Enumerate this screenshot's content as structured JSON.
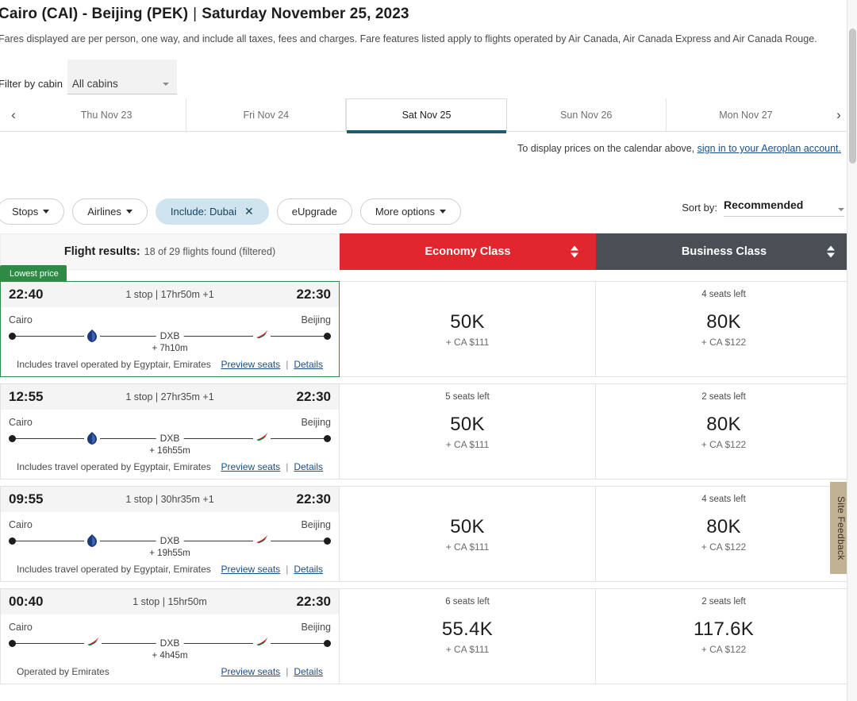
{
  "header": {
    "route": "Cairo (CAI) - Beijing (PEK)",
    "separator": "|",
    "date": "Saturday November 25, 2023",
    "disclaimer": "Fares displayed are per person, one way, and include all taxes, fees and charges. Fare features listed apply to flights operated by Air Canada, Air Canada Express and Air Canada Rouge."
  },
  "cabin_filter": {
    "label": "Filter by cabin",
    "value": "All cabins"
  },
  "date_tabs": {
    "prev_icon": "‹",
    "next_icon": "›",
    "items": [
      {
        "label": "Thu Nov 23",
        "active": false
      },
      {
        "label": "Fri Nov 24",
        "active": false
      },
      {
        "label": "Sat Nov 25",
        "active": true
      },
      {
        "label": "Sun Nov 26",
        "active": false
      },
      {
        "label": "Mon Nov 27",
        "active": false
      }
    ],
    "signin_note_prefix": "To display prices on the calendar above, ",
    "signin_link": "sign in to your Aeroplan account."
  },
  "filters": {
    "chips": [
      {
        "label": "Stops",
        "caret": true,
        "active": false,
        "close": false
      },
      {
        "label": "Airlines",
        "caret": true,
        "active": false,
        "close": false
      },
      {
        "label": "Include: Dubai",
        "caret": false,
        "active": true,
        "close": true
      },
      {
        "label": "eUpgrade",
        "caret": false,
        "active": false,
        "close": false
      },
      {
        "label": "More options",
        "caret": true,
        "active": false,
        "close": false
      }
    ],
    "close_icon": "✕"
  },
  "sort": {
    "label": "Sort by:",
    "value": "Recommended"
  },
  "results_header": {
    "title": "Flight results:",
    "count": "18 of 29 flights found (filtered)",
    "columns": [
      {
        "label": "Economy Class",
        "color": "#e1262d"
      },
      {
        "label": "Business Class",
        "color": "#4a4f55"
      }
    ]
  },
  "flights": [
    {
      "badge": "Lowest price",
      "depart_time": "22:40",
      "summary": "1 stop | 17hr50m +1",
      "arrive_time": "22:30",
      "origin": "Cairo",
      "destination": "Beijing",
      "stop_code": "DXB",
      "layover": "+ 7h10m",
      "operated_by": "Includes travel operated by Egyptair, Emirates",
      "preview_link": "Preview seats",
      "details_link": "Details",
      "link_divider": "|",
      "airline_1": "egyptair-logo-icon",
      "airline_2": "emirates-logo-icon",
      "economy": {
        "seats": "",
        "points": "50K",
        "cash": "+ CA $111"
      },
      "business": {
        "seats": "4 seats left",
        "points": "80K",
        "cash": "+ CA $122"
      }
    },
    {
      "badge": "",
      "depart_time": "12:55",
      "summary": "1 stop | 27hr35m +1",
      "arrive_time": "22:30",
      "origin": "Cairo",
      "destination": "Beijing",
      "stop_code": "DXB",
      "layover": "+ 16h55m",
      "operated_by": "Includes travel operated by Egyptair, Emirates",
      "preview_link": "Preview seats",
      "details_link": "Details",
      "link_divider": "|",
      "airline_1": "egyptair-logo-icon",
      "airline_2": "emirates-logo-icon",
      "economy": {
        "seats": "5 seats left",
        "points": "50K",
        "cash": "+ CA $111"
      },
      "business": {
        "seats": "2 seats left",
        "points": "80K",
        "cash": "+ CA $122"
      }
    },
    {
      "badge": "",
      "depart_time": "09:55",
      "summary": "1 stop | 30hr35m +1",
      "arrive_time": "22:30",
      "origin": "Cairo",
      "destination": "Beijing",
      "stop_code": "DXB",
      "layover": "+ 19h55m",
      "operated_by": "Includes travel operated by Egyptair, Emirates",
      "preview_link": "Preview seats",
      "details_link": "Details",
      "link_divider": "|",
      "airline_1": "egyptair-logo-icon",
      "airline_2": "emirates-logo-icon",
      "economy": {
        "seats": "",
        "points": "50K",
        "cash": "+ CA $111"
      },
      "business": {
        "seats": "4 seats left",
        "points": "80K",
        "cash": "+ CA $122"
      }
    },
    {
      "badge": "",
      "depart_time": "00:40",
      "summary": "1 stop | 15hr50m",
      "arrive_time": "22:30",
      "origin": "Cairo",
      "destination": "Beijing",
      "stop_code": "DXB",
      "layover": "+ 4h45m",
      "operated_by": "Operated by Emirates",
      "preview_link": "Preview seats",
      "details_link": "Details",
      "link_divider": "|",
      "airline_1": "emirates-logo-icon",
      "airline_2": "emirates-logo-icon",
      "economy": {
        "seats": "6 seats left",
        "points": "55.4K",
        "cash": "+ CA $111"
      },
      "business": {
        "seats": "2 seats left",
        "points": "117.6K",
        "cash": "+ CA $122"
      }
    }
  ],
  "feedback": {
    "label": "Site Feedback"
  }
}
